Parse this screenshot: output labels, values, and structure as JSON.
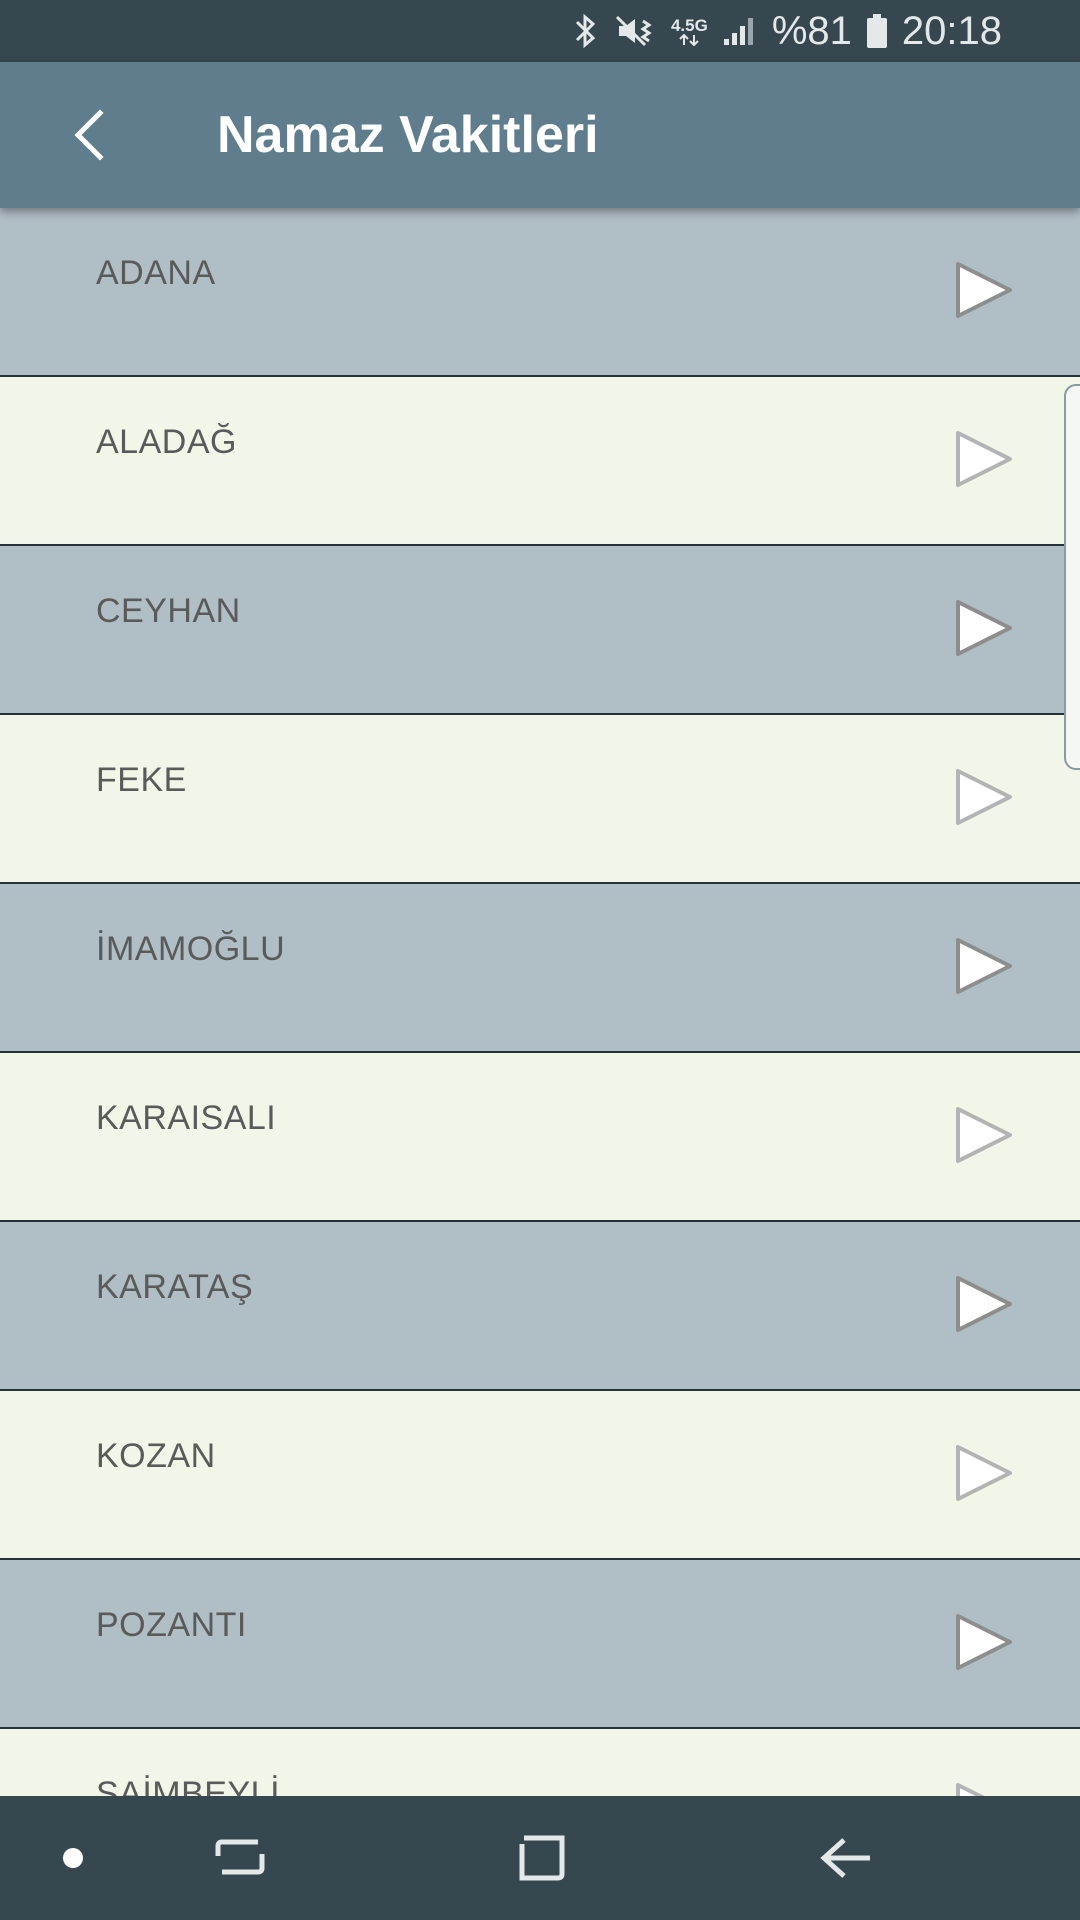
{
  "status_bar": {
    "network": "4.5G",
    "battery": "%81",
    "time": "20:18",
    "icons": [
      "bluetooth-icon",
      "mute-vibrate-icon",
      "network-type-icon",
      "signal-icon",
      "battery-icon"
    ]
  },
  "app_bar": {
    "title": "Namaz Vakitleri",
    "back_icon": "chevron-left-icon"
  },
  "list": {
    "items": [
      {
        "label": "ADANA"
      },
      {
        "label": "ALADAĞ"
      },
      {
        "label": "CEYHAN"
      },
      {
        "label": "FEKE"
      },
      {
        "label": "İMAMOĞLU"
      },
      {
        "label": "KARAISALI"
      },
      {
        "label": "KARATAŞ"
      },
      {
        "label": "KOZAN"
      },
      {
        "label": "POZANTI"
      },
      {
        "label": "SAİMBEYLİ"
      }
    ],
    "row_colors": {
      "dark": "#b0bec5",
      "light": "#f1f6e9"
    },
    "item_icon": "play-arrow-icon"
  },
  "nav_bar": {
    "buttons": [
      "home-dot-icon",
      "recents-icon",
      "home-square-icon",
      "back-arrow-icon"
    ]
  },
  "colors": {
    "status_bar": "#37474f",
    "app_bar": "#5f7d8c",
    "nav_bar": "#37474f"
  }
}
